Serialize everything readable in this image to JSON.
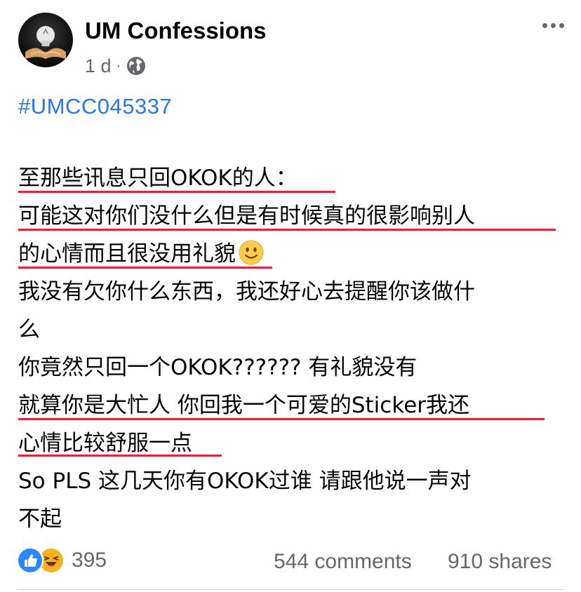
{
  "post": {
    "page_name": "UM Confessions",
    "time": "1 d",
    "separator": "·",
    "privacy_icon": "globe-icon",
    "hashtag": "#UMCC045337",
    "lines": [
      "至那些讯息只回OKOK的人：",
      "可能这对你们没什么但是有时候真的很影响别人",
      "的心情而且很没用礼貌",
      "我没有欠你什么东西，我还好心去提醒你该做什",
      "么",
      "你竟然只回一个OKOK?????? 有礼貌没有",
      "就算你是大忙人 你回我一个可爱的Sticker我还",
      "心情比较舒服一点",
      "So PLS 这几天你有OKOK过谁 请跟他说一声对",
      "不起"
    ],
    "emoji": "slightly-smiling-face",
    "underline_color": "#e0263b"
  },
  "footer": {
    "reaction_icons": [
      "like-icon",
      "haha-icon"
    ],
    "reaction_count": "395",
    "comments": "544 comments",
    "shares": "910 shares"
  },
  "colors": {
    "hashtag": "#2a77e4",
    "meta_text": "#65676b",
    "like_blue": "#2d88ff",
    "haha_yellow": "#f7b125"
  }
}
